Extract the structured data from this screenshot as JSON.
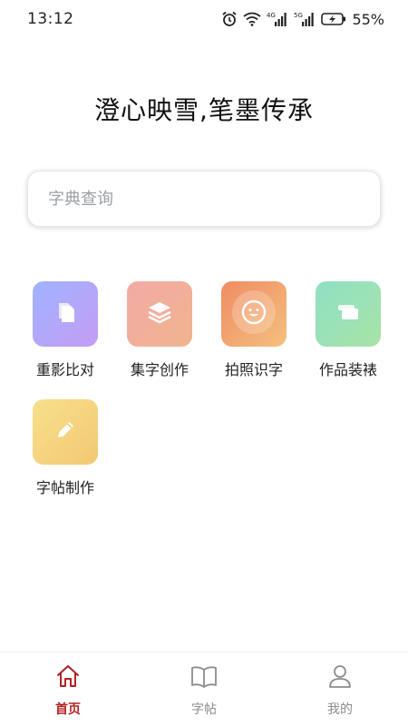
{
  "status_bar": {
    "time": "13:12",
    "icons": [
      "alarm-icon",
      "wifi-icon",
      "4g-signal-icon",
      "5g-signal-icon",
      "battery-charging-icon"
    ],
    "network_4g": "4G",
    "network_5g": "5G",
    "battery": "55%"
  },
  "header": {
    "slogan": "澄心映雪,笔墨传承"
  },
  "search": {
    "placeholder": "字典查询",
    "value": ""
  },
  "features": [
    {
      "label": "重影比对",
      "icon": "copy-icon",
      "gradient_from": "#9fb3ff",
      "gradient_to": "#c59cf5"
    },
    {
      "label": "集字创作",
      "icon": "layers-icon",
      "gradient_from": "#f2aaa5",
      "gradient_to": "#f0b48e"
    },
    {
      "label": "拍照识字",
      "icon": "smile-icon",
      "gradient_from": "#ef8c63",
      "gradient_to": "#f4c07e"
    },
    {
      "label": "作品装裱",
      "icon": "scroll-icon",
      "gradient_from": "#8fe0c6",
      "gradient_to": "#a8e3a6"
    },
    {
      "label": "字帖制作",
      "icon": "pencil-icon",
      "gradient_from": "#f8e08c",
      "gradient_to": "#f2c873"
    }
  ],
  "bottom_nav": {
    "items": [
      {
        "label": "首页",
        "icon": "home-icon",
        "active": true
      },
      {
        "label": "字帖",
        "icon": "book-icon",
        "active": false
      },
      {
        "label": "我的",
        "icon": "user-icon",
        "active": false
      }
    ],
    "active_color": "#b22222",
    "inactive_color": "#8c8c8c"
  }
}
